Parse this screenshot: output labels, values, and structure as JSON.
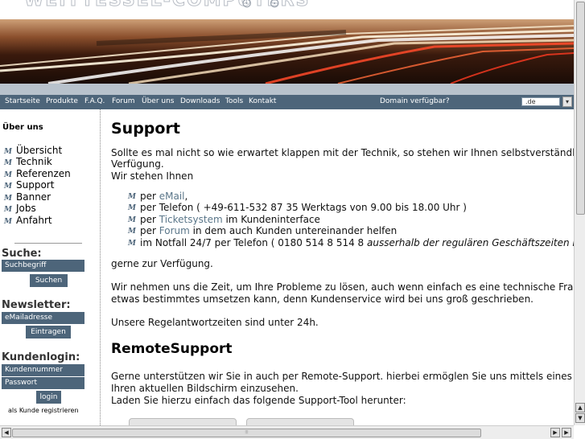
{
  "logo": {
    "text": "WEITTESSEL-COMPUTERS",
    "marks": "⊙ ⊙"
  },
  "nav": {
    "items": [
      "Startseite",
      "Produkte",
      "F.A.Q.",
      "Forum",
      "Über uns",
      "Downloads",
      "Tools",
      "Kontakt"
    ],
    "domain_label": "Domain verfügbar?",
    "domain_tld": ".de"
  },
  "sidebar": {
    "heading": "Über uns",
    "bullet_glyph": "M",
    "links": [
      "Übersicht",
      "Technik",
      "Referenzen",
      "Support",
      "Banner",
      "Jobs",
      "Anfahrt"
    ],
    "search": {
      "title": "Suche:",
      "placeholder": "Suchbegriff",
      "button": "Suchen"
    },
    "newsletter": {
      "title": "Newsletter:",
      "placeholder": "eMailadresse",
      "button": "Eintragen"
    },
    "login": {
      "title": "Kundenlogin:",
      "user_placeholder": "Kundennummer",
      "pass_placeholder": "Passwort",
      "button": "login",
      "register": "als Kunde registrieren"
    }
  },
  "content": {
    "title": "Support",
    "intro_1": "Sollte es mal nicht so wie erwartet klappen mit der Technik, so stehen wir Ihnen selbstverständlich im",
    "intro_2": "Verfügung.",
    "intro_3": "Wir stehen Ihnen",
    "list": [
      {
        "pre": "per ",
        "link": "eMail",
        "post": ","
      },
      {
        "pre": "per Telefon ( +49-611-532 87 35 Werktags von 9.00 bis 18.00 Uhr )",
        "link": "",
        "post": ""
      },
      {
        "pre": "per ",
        "link": "Ticketsystem",
        "post": " im Kundeninterface"
      },
      {
        "pre": "per ",
        "link": "Forum",
        "post": " in dem auch Kunden untereinander helfen"
      },
      {
        "pre": "im Notfall 24/7 per Telefon ( 0180 514 8 514 8 ",
        "link": "",
        "post": "",
        "italic": "ausserhalb der regulären Geschäftszeiten nur No"
      }
    ],
    "outro": "gerne zur Verfügung.",
    "para2_1": "Wir nehmen uns die Zeit, um Ihre Probleme zu lösen, auch wenn einfach es eine technische Frage ist",
    "para2_2": "etwas bestimmtes umsetzen kann, denn Kundenservice wird bei uns groß geschrieben.",
    "para3": "Unsere Regelantwortzeiten sind unter 24h.",
    "title2": "RemoteSupport",
    "remote_1": "Gerne unterstützen wir Sie in auch per Remote-Support. hierbei ermöglen Sie uns mittels eines kleine",
    "remote_2": "Ihren aktuellen Bildschirm einzusehen.",
    "remote_3": "Laden Sie hierzu einfach das folgende Support-Tool herunter:"
  },
  "scrollbars": {
    "up": "▲",
    "down": "▼",
    "left": "◀",
    "right": "▶",
    "grip": "⦙⦙⦙"
  },
  "colors": {
    "nav_bg": "#4d657a",
    "link": "#5a7689",
    "accent": "#4d657a"
  }
}
